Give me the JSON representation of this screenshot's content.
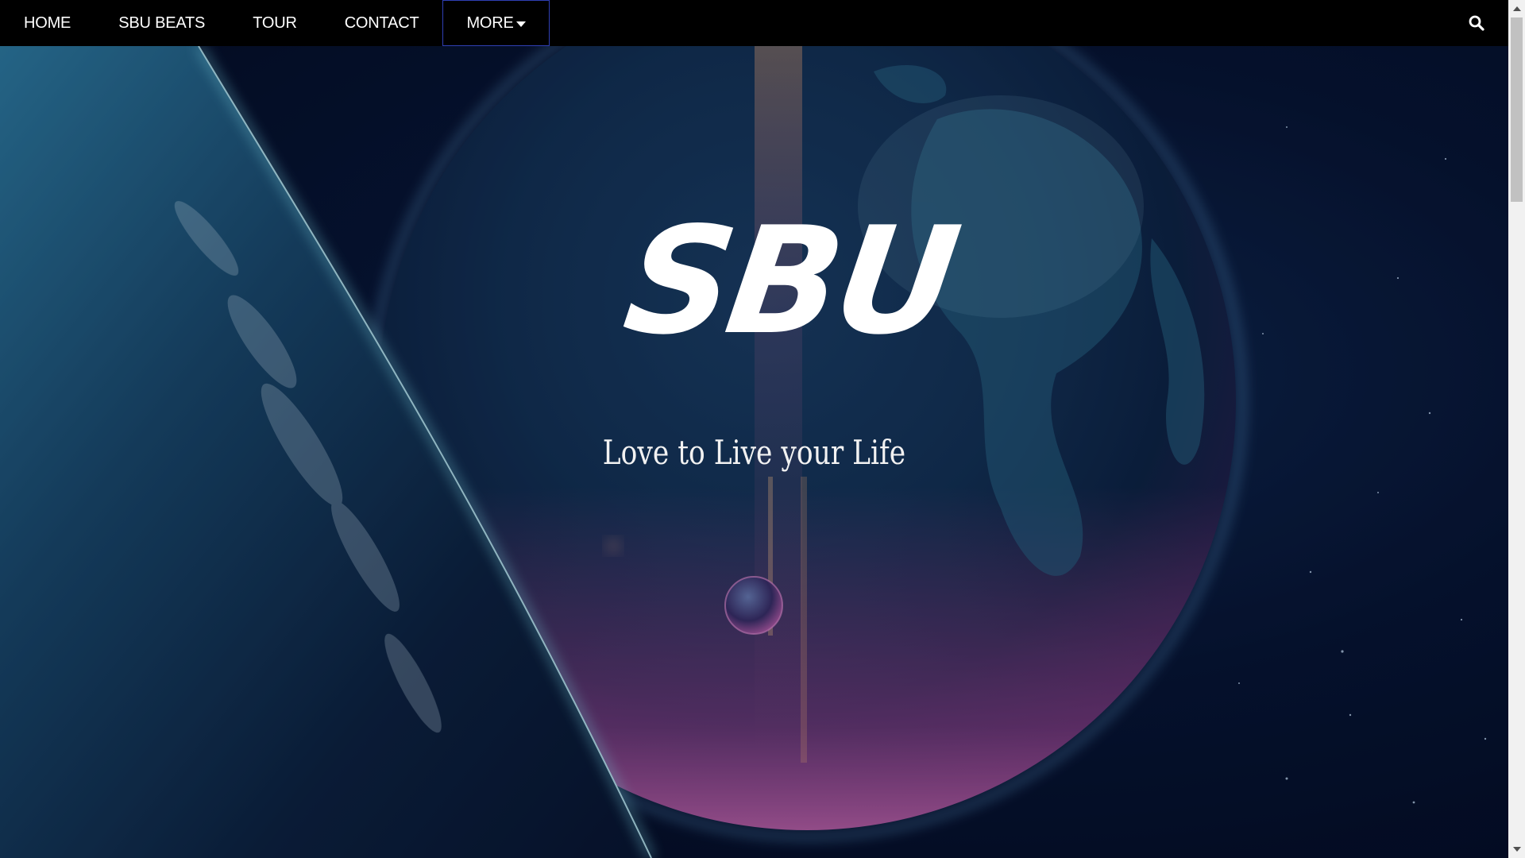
{
  "nav": {
    "items": [
      {
        "label": "HOME"
      },
      {
        "label": "SBU BEATS"
      },
      {
        "label": "TOUR"
      },
      {
        "label": "CONTACT"
      }
    ],
    "more": {
      "label": "MORE",
      "icon": "caret-down-icon"
    },
    "search": {
      "icon": "search-icon"
    }
  },
  "hero": {
    "logo": "SBU",
    "tagline": "Love to Live your Life",
    "background": "space-planets-illustration"
  },
  "colors": {
    "nav_bg": "#000000",
    "nav_text": "#ffffff",
    "more_border": "#2f3fb4",
    "space_dark": "#050a1e",
    "planet_blue": "#1a4a6e",
    "planet_pink": "#c04a9a",
    "atmosphere_cyan": "#5fe0ff"
  }
}
